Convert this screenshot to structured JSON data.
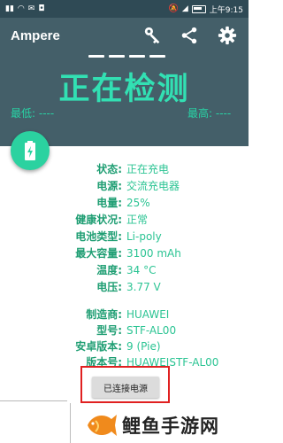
{
  "status_bar": {
    "time": "上午9:15"
  },
  "app": {
    "title": "Ampere"
  },
  "toolbar": {
    "icons": [
      "key-icon",
      "share-icon",
      "gear-icon"
    ]
  },
  "measure": {
    "status": "正在检测",
    "min_label": "最低: ----",
    "max_label": "最高: ----"
  },
  "details": [
    {
      "key": "状态:",
      "value": "正在充电"
    },
    {
      "key": "电源:",
      "value": "交流充电器"
    },
    {
      "key": "电量:",
      "value": "25%"
    },
    {
      "key": "健康状况:",
      "value": "正常"
    },
    {
      "key": "电池类型:",
      "value": "Li-poly"
    },
    {
      "key": "最大容量:",
      "value": "3100 mAh"
    },
    {
      "key": "温度:",
      "value": "34 °C"
    },
    {
      "key": "电压:",
      "value": "3.77 V"
    },
    {
      "key": "制造商:",
      "value": "HUAWEI"
    },
    {
      "key": "型号:",
      "value": "STF-AL00"
    },
    {
      "key": "安卓版本:",
      "value": "9 (Pie)"
    },
    {
      "key": "版本号:",
      "value": "HUAWEISTF-AL00"
    }
  ],
  "button": {
    "label": "已连接电源"
  },
  "watermark": {
    "text": "鲤鱼手游网"
  },
  "colors": {
    "app_bar": "#445f69",
    "accent": "#2bd2a0",
    "key_text": "#1f9e73",
    "highlight": "#e02020"
  }
}
